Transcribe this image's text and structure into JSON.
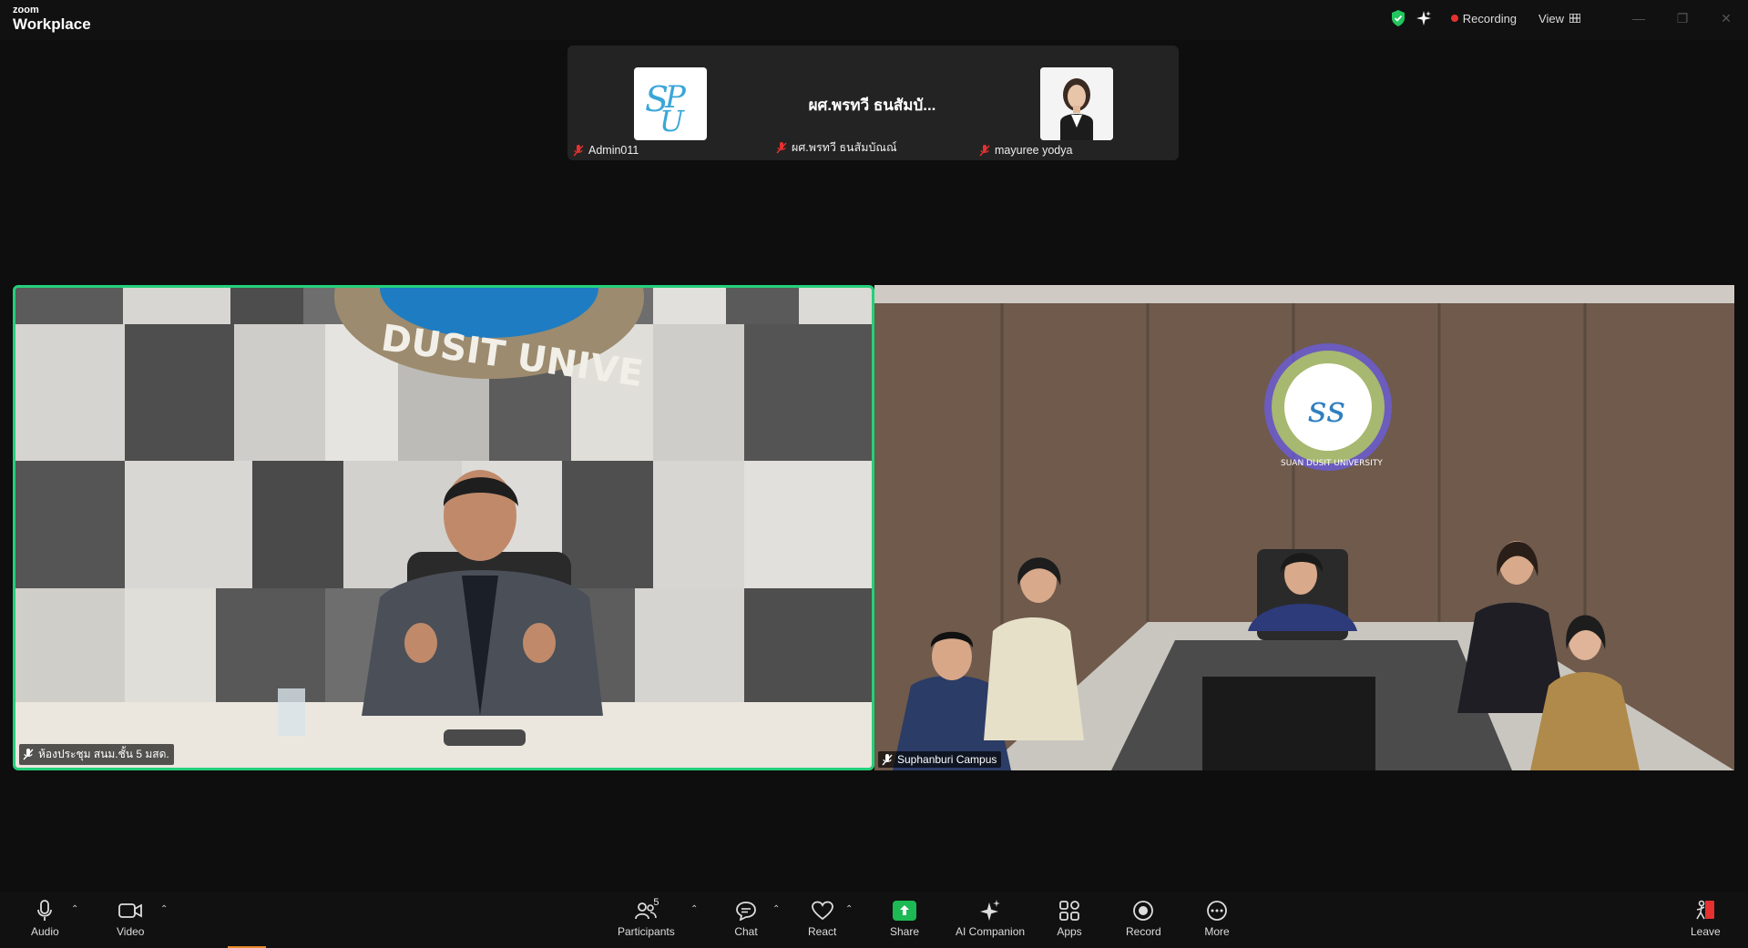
{
  "app": {
    "logo_top": "zoom",
    "logo_bottom": "Workplace"
  },
  "titlebar": {
    "recording_label": "Recording",
    "view_label": "View",
    "colors": {
      "shield": "#22c55e",
      "recording_dot": "#e5312f"
    }
  },
  "thumbnails": [
    {
      "name": "Admin011",
      "avatar": "spu-logo",
      "muted": true
    },
    {
      "name": "ผศ.พรทวี ธนสัมบัณณ์",
      "display_text": "ผศ.พรทวี ธนสัมบั...",
      "muted": true
    },
    {
      "name": "mayuree yodya",
      "avatar": "profile-photo",
      "muted": true
    }
  ],
  "videos": [
    {
      "name": "ห้องประชุม สนม.ชั้น 5 มสด.",
      "active_speaker": true,
      "banner_text": "DUSIT UNIVE"
    },
    {
      "name": "Suphanburi Campus",
      "active_speaker": false,
      "emblem_text": "SUAN DUSIT UNIVERSITY"
    }
  ],
  "toolbar": {
    "audio": "Audio",
    "video": "Video",
    "participants": "Participants",
    "participants_count": "5",
    "chat": "Chat",
    "react": "React",
    "share": "Share",
    "ai_companion": "AI Companion",
    "apps": "Apps",
    "record": "Record",
    "more": "More",
    "leave": "Leave",
    "colors": {
      "share": "#1db954",
      "active_speaker_border": "#24d07a",
      "leave": "#e5312f"
    }
  }
}
